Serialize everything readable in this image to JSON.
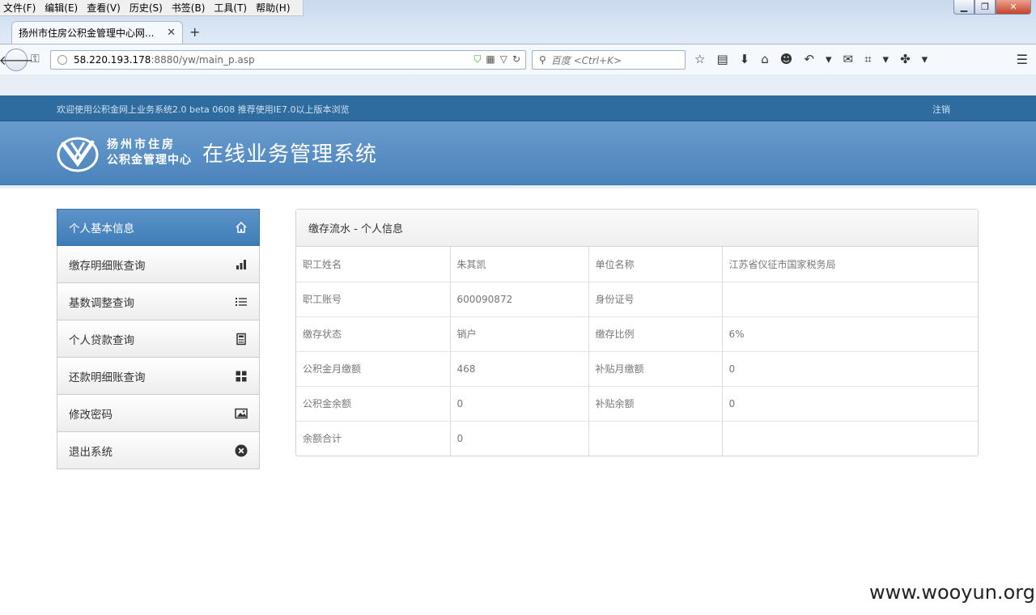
{
  "browser": {
    "menu": [
      "文件(F)",
      "编辑(E)",
      "查看(V)",
      "历史(S)",
      "书签(B)",
      "工具(T)",
      "帮助(H)"
    ],
    "tab_title": "扬州市住房公积金管理中心网...",
    "url_host": "58.220.193.178",
    "url_path": ":8880/yw/main_p.asp",
    "search_placeholder": "百度 <Ctrl+K>"
  },
  "page": {
    "welcome": "欢迎使用公积金网上业务系统2.0 beta 0608 推荐使用IE7.0以上版本浏览",
    "logout": "注销",
    "org_line1": "扬州市住房",
    "org_line2": "公积金管理中心",
    "system_title": "在线业务管理系统"
  },
  "sidebar": {
    "items": [
      {
        "label": "个人基本信息",
        "icon": "home-icon"
      },
      {
        "label": "缴存明细账查询",
        "icon": "bar-chart-icon"
      },
      {
        "label": "基数调整查询",
        "icon": "list-icon"
      },
      {
        "label": "个人贷款查询",
        "icon": "calculator-icon"
      },
      {
        "label": "还款明细账查询",
        "icon": "grid-icon"
      },
      {
        "label": "修改密码",
        "icon": "picture-icon"
      },
      {
        "label": "退出系统",
        "icon": "close-circle-icon"
      }
    ]
  },
  "panel": {
    "title": "缴存流水 - 个人信息",
    "rows": [
      [
        "职工姓名",
        "朱其凯",
        "单位名称",
        "江苏省仪征市国家税务局"
      ],
      [
        "职工账号",
        "600090872",
        "身份证号",
        ""
      ],
      [
        "缴存状态",
        "销户",
        "缴存比例",
        "6%"
      ],
      [
        "公积金月缴额",
        "468",
        "补贴月缴额",
        "0"
      ],
      [
        "公积金余额",
        "0",
        "补贴余额",
        "0"
      ],
      [
        "余额合计",
        "0",
        "",
        ""
      ]
    ]
  },
  "watermark": "www.wooyun.org",
  "colors": {
    "header_blue": "#2e6b9e",
    "banner_blue": "#5a90c5",
    "active_item": "#4a86c0"
  }
}
